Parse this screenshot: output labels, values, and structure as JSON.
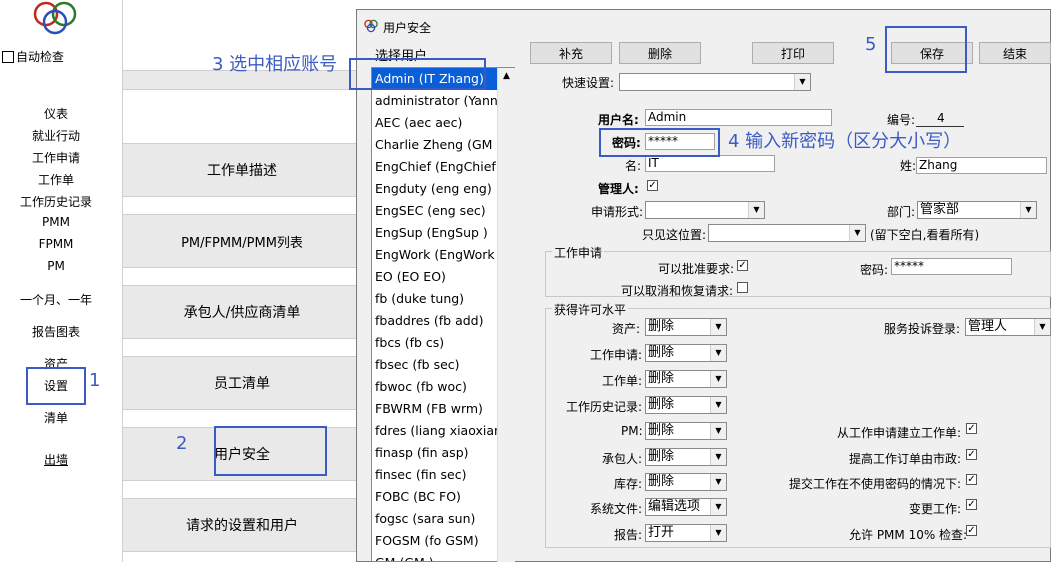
{
  "left_nav": {
    "auto_check": "自动检查",
    "items": [
      "仪表",
      "就业行动",
      "工作申请",
      "工作单",
      "工作历史记录",
      "PMM",
      "FPMM",
      "PM",
      "一个月、一年",
      "报告图表",
      "资产",
      "设置",
      "清单",
      "出墙"
    ]
  },
  "center_menu": [
    "工作单描述",
    "PM/FPMM/PMM列表",
    "承包人/供应商清单",
    "员工清单",
    "用户安全",
    "请求的设置和用户"
  ],
  "dialog": {
    "title": "用户安全",
    "select_user_label": "选择用户",
    "users": [
      "Admin (IT Zhang)",
      "administrator (Yanny",
      "AEC (aec aec)",
      "Charlie Zheng (GM G",
      "EngChief (EngChief )",
      "Engduty (eng eng)",
      "EngSEC (eng sec)",
      "EngSup (EngSup )",
      "EngWork (EngWork )",
      "EO (EO EO)",
      "fb (duke tung)",
      "fbaddres (fb add)",
      "fbcs (fb cs)",
      "fbsec (fb sec)",
      "fbwoc (fb woc)",
      "FBWRM (FB wrm)",
      "fdres (liang xiaoxian)",
      "finasp (fin asp)",
      "finsec (fin sec)",
      "FOBC (BC FO)",
      "fogsc (sara sun)",
      "FOGSM (fo GSM)",
      "GM (GM )"
    ],
    "buttons": {
      "add": "补充",
      "delete": "删除",
      "print": "打印",
      "save": "保存",
      "close": "结束"
    },
    "quick_settings_label": "快速设置:",
    "username_label": "用户名:",
    "username_value": "Admin",
    "id_label": "编号:",
    "id_value": "4",
    "password_label": "密码:",
    "password_value": "*****",
    "first_name_label": "名:",
    "first_name_value": "IT",
    "last_name_label": "姓:",
    "last_name_value": "Zhang",
    "admin_label": "管理人:",
    "request_form_label": "申请形式:",
    "department_label": "部门:",
    "department_value": "管家部",
    "location_only_label": "只见这位置:",
    "location_hint": "(留下空白,看看所有)",
    "work_request_group": "工作申请",
    "can_approve_label": "可以批准要求:",
    "request_password_label": "密码:",
    "request_password_value": "*****",
    "can_cancel_label": "可以取消和恢复请求:",
    "permission_group": "获得许可水平",
    "permissions_left": [
      {
        "label": "资产:",
        "value": "删除"
      },
      {
        "label": "工作申请:",
        "value": "删除"
      },
      {
        "label": "工作单:",
        "value": "删除"
      },
      {
        "label": "工作历史记录:",
        "value": "删除"
      },
      {
        "label": "PM:",
        "value": "删除"
      },
      {
        "label": "承包人:",
        "value": "删除"
      },
      {
        "label": "库存:",
        "value": "删除"
      },
      {
        "label": "系统文件:",
        "value": "编辑选项"
      },
      {
        "label": "报告:",
        "value": "打开"
      }
    ],
    "service_complaint_label": "服务投诉登录:",
    "service_complaint_value": "管理人",
    "checks_right": [
      "从工作申请建立工作单:",
      "提高工作订单由市政:",
      "提交工作在不使用密码的情况下:",
      "变更工作:",
      "允许 PMM 10% 检查:"
    ]
  },
  "annotations": {
    "step1": "1",
    "step2": "2",
    "step3": "3 选中相应账号",
    "step4": "4 输入新密码（区分大小写）",
    "step5": "5"
  },
  "colors": {
    "accent": "#3b5bc4",
    "selection": "#0a5fd8"
  }
}
